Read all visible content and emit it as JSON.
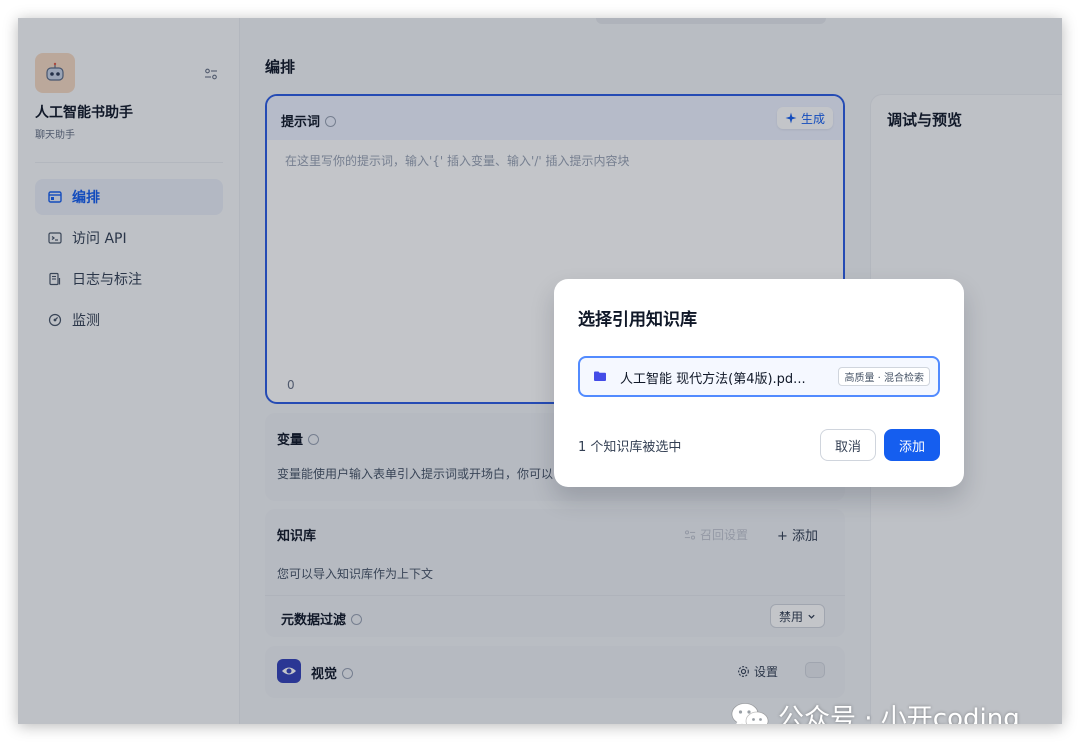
{
  "sidebar": {
    "app_name": "人工智能书助手",
    "app_type": "聊天助手",
    "items": [
      {
        "label": "编排",
        "icon": "layout-icon",
        "active": true
      },
      {
        "label": "访问 API",
        "icon": "terminal-icon",
        "active": false
      },
      {
        "label": "日志与标注",
        "icon": "log-icon",
        "active": false
      },
      {
        "label": "监测",
        "icon": "monitor-icon",
        "active": false
      }
    ]
  },
  "main": {
    "title": "编排",
    "prompt": {
      "label": "提示词",
      "generate_label": "生成",
      "placeholder": "在这里写你的提示词，输入'{' 插入变量、输入'/' 插入提示内容块",
      "count": "0"
    },
    "variables": {
      "title": "变量",
      "desc": "变量能使用户输入表单引入提示词或开场白，你可以"
    },
    "knowledge": {
      "title": "知识库",
      "recall_label": "召回设置",
      "add_label": "+ 添加",
      "desc": "您可以导入知识库作为上下文",
      "metadata_label": "元数据过滤",
      "metadata_value": "禁用"
    },
    "vision": {
      "title": "视觉",
      "settings_label": "设置"
    }
  },
  "preview": {
    "title": "调试与预览"
  },
  "modal": {
    "title": "选择引用知识库",
    "kb_name": "人工智能 现代方法(第4版).pd...",
    "kb_badge": "高质量 · 混合检索",
    "selected_count": "1 个知识库被选中",
    "cancel_label": "取消",
    "add_label": "添加"
  },
  "watermark": {
    "text": "公众号 · 小开coding"
  },
  "colors": {
    "accent": "#155eef",
    "border_focus": "#2d5de3",
    "vision_badge": "#3442b8"
  }
}
